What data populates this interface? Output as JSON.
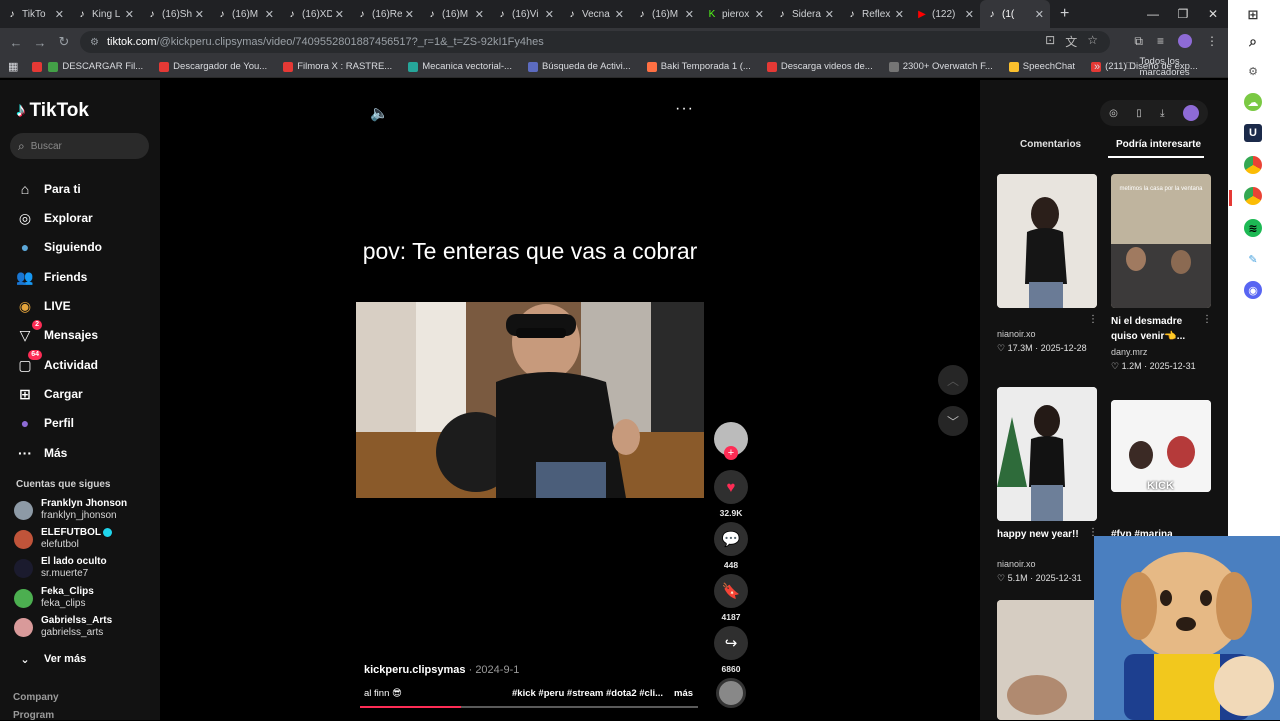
{
  "browser": {
    "tabs": [
      {
        "title": "TikTo",
        "icon": "tiktok-icon"
      },
      {
        "title": "King L",
        "icon": "tiktok-icon"
      },
      {
        "title": "(16)Sh",
        "icon": "tiktok-icon"
      },
      {
        "title": "(16)M",
        "icon": "tiktok-icon"
      },
      {
        "title": "(16)XD",
        "icon": "tiktok-icon"
      },
      {
        "title": "(16)Re",
        "icon": "tiktok-icon"
      },
      {
        "title": "(16)M",
        "icon": "tiktok-icon"
      },
      {
        "title": "(16)Vi",
        "icon": "tiktok-icon"
      },
      {
        "title": "Vecna",
        "icon": "tiktok-icon"
      },
      {
        "title": "(16)M",
        "icon": "tiktok-icon"
      },
      {
        "title": "pierox",
        "icon": "kick-icon"
      },
      {
        "title": "Sidera",
        "icon": "tiktok-icon"
      },
      {
        "title": "Reflex",
        "icon": "tiktok-icon"
      },
      {
        "title": "(122)",
        "icon": "youtube-icon"
      },
      {
        "title": "(1(",
        "icon": "tiktok-icon",
        "active": true
      }
    ],
    "url_host": "tiktok.com",
    "url_path": "/@kickperu.clipsymas/video/7409552801887456517?_r=1&_t=ZS-92kI1Fy4hes",
    "bookmarks": [
      {
        "label": "",
        "color": "#e53935"
      },
      {
        "label": "DESCARGAR Fil...",
        "color": "#43a047"
      },
      {
        "label": "Descargador de You...",
        "color": "#e53935"
      },
      {
        "label": "Filmora X : RASTRE...",
        "color": "#e53935"
      },
      {
        "label": "Mecanica vectorial-...",
        "color": "#26a69a"
      },
      {
        "label": "Búsqueda de Activi...",
        "color": "#5c6bc0"
      },
      {
        "label": "Baki Temporada 1 (...",
        "color": "#ff7043"
      },
      {
        "label": "Descarga videos de...",
        "color": "#e53935"
      },
      {
        "label": "2300+ Overwatch F...",
        "color": "#757575"
      },
      {
        "label": "SpeechChat",
        "color": "#fbc02d"
      },
      {
        "label": "(211) Diseño de exp...",
        "color": "#e53935"
      }
    ],
    "all_bookmarks": "Todos los marcadores"
  },
  "nav": {
    "logo": "TikTok",
    "search_placeholder": "Buscar",
    "items": [
      {
        "label": "Para ti",
        "icon": "home-icon"
      },
      {
        "label": "Explorar",
        "icon": "compass-icon"
      },
      {
        "label": "Siguiendo",
        "icon": "following-avatar-icon"
      },
      {
        "label": "Friends",
        "icon": "friends-icon"
      },
      {
        "label": "LIVE",
        "icon": "live-icon"
      },
      {
        "label": "Mensajes",
        "icon": "messages-icon",
        "badge": "2"
      },
      {
        "label": "Actividad",
        "icon": "activity-icon",
        "badge": "64"
      },
      {
        "label": "Cargar",
        "icon": "upload-icon"
      },
      {
        "label": "Perfil",
        "icon": "profile-icon"
      },
      {
        "label": "Más",
        "icon": "more-icon"
      }
    ],
    "following_title": "Cuentas que sigues",
    "accounts": [
      {
        "name": "Franklyn Jhonson",
        "handle": "franklyn_jhonson",
        "color": "#8d9aa6"
      },
      {
        "name": "ELEFUTBOL",
        "handle": "elefutbol",
        "color": "#c0543a",
        "verified": true
      },
      {
        "name": "El lado oculto",
        "handle": "sr.muerte7",
        "color": "#1b1b2e"
      },
      {
        "name": "Feka_Clips",
        "handle": "feka_clips",
        "color": "#4caf50"
      },
      {
        "name": "Gabrielss_Arts",
        "handle": "gabrielss_arts",
        "color": "#d99a9a"
      }
    ],
    "see_more": "Ver más",
    "footer": [
      "Company",
      "Program"
    ]
  },
  "video": {
    "caption": "pov: Te enteras que vas a cobrar",
    "author": "kickperu.clipsymas",
    "date": "2024-9-1",
    "description": "al finn 😎",
    "tags": "#kick #peru #stream #dota2 #cli...",
    "more": "más",
    "progress": 0.3,
    "stats": {
      "likes": "32.9K",
      "comments": "448",
      "saves": "4187",
      "shares": "6860"
    }
  },
  "right": {
    "tabs": [
      "Comentarios",
      "Podría interesarte"
    ],
    "active_tab": "Podría interesarte",
    "items": [
      {
        "caption": "",
        "user": "nianoir.xo",
        "likes": "17.3M",
        "date": "2025-12-28"
      },
      {
        "caption": "Ni el desmadre quiso venir👈...",
        "user": "dany.mrz",
        "likes": "1.2M",
        "date": "2025-12-31"
      },
      {
        "caption": "happy new year!!",
        "user": "nianoir.xo",
        "likes": "5.1M",
        "date": "2025-12-31"
      },
      {
        "caption": "#fyp #marina",
        "user": "",
        "likes": "",
        "date": ""
      }
    ],
    "thumb2_overlay": "metimos la casa por la ventana",
    "thumb4_overlay": "KICK"
  }
}
